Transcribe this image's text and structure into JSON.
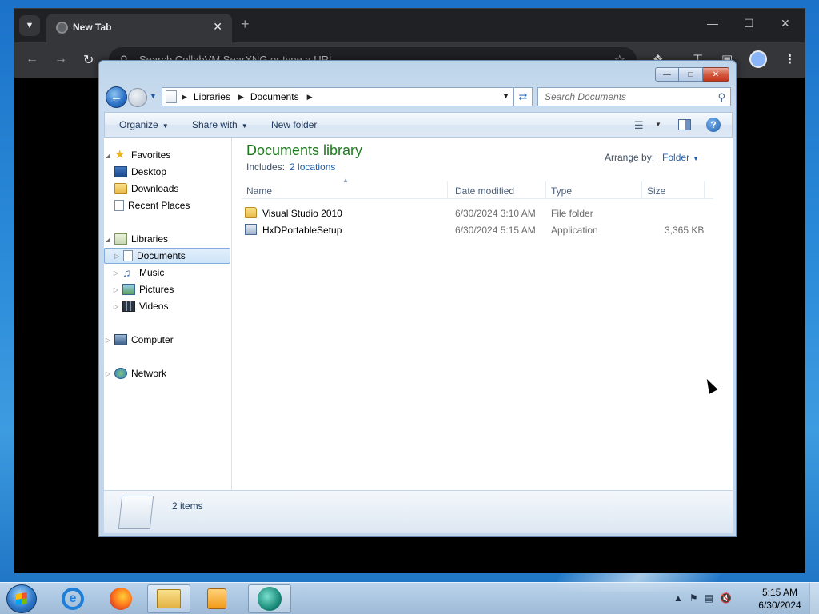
{
  "browser": {
    "tab_title": "New Tab",
    "tab_close": "✕",
    "new_tab": "+",
    "omnibox_placeholder": "Search CollabVM SearXNG or type a URL"
  },
  "explorer": {
    "breadcrumb": [
      "Libraries",
      "Documents"
    ],
    "search_placeholder": "Search Documents",
    "commands": {
      "organize": "Organize",
      "share_with": "Share with",
      "new_folder": "New folder"
    },
    "nav": {
      "favorites": "Favorites",
      "desktop": "Desktop",
      "downloads": "Downloads",
      "recent_places": "Recent Places",
      "libraries": "Libraries",
      "documents": "Documents",
      "music": "Music",
      "pictures": "Pictures",
      "videos": "Videos",
      "computer": "Computer",
      "network": "Network"
    },
    "library_title": "Documents library",
    "includes_label": "Includes:",
    "includes_link": "2 locations",
    "arrange_label": "Arrange by:",
    "arrange_value": "Folder",
    "columns": {
      "name": "Name",
      "date_modified": "Date modified",
      "type": "Type",
      "size": "Size"
    },
    "files": [
      {
        "name": "Visual Studio 2010",
        "date": "6/30/2024 3:10 AM",
        "type": "File folder",
        "size": ""
      },
      {
        "name": "HxDPortableSetup",
        "date": "6/30/2024 5:15 AM",
        "type": "Application",
        "size": "3,365 KB"
      }
    ],
    "status": "2 items"
  },
  "taskbar": {
    "time": "5:15 AM",
    "date": "6/30/2024"
  }
}
